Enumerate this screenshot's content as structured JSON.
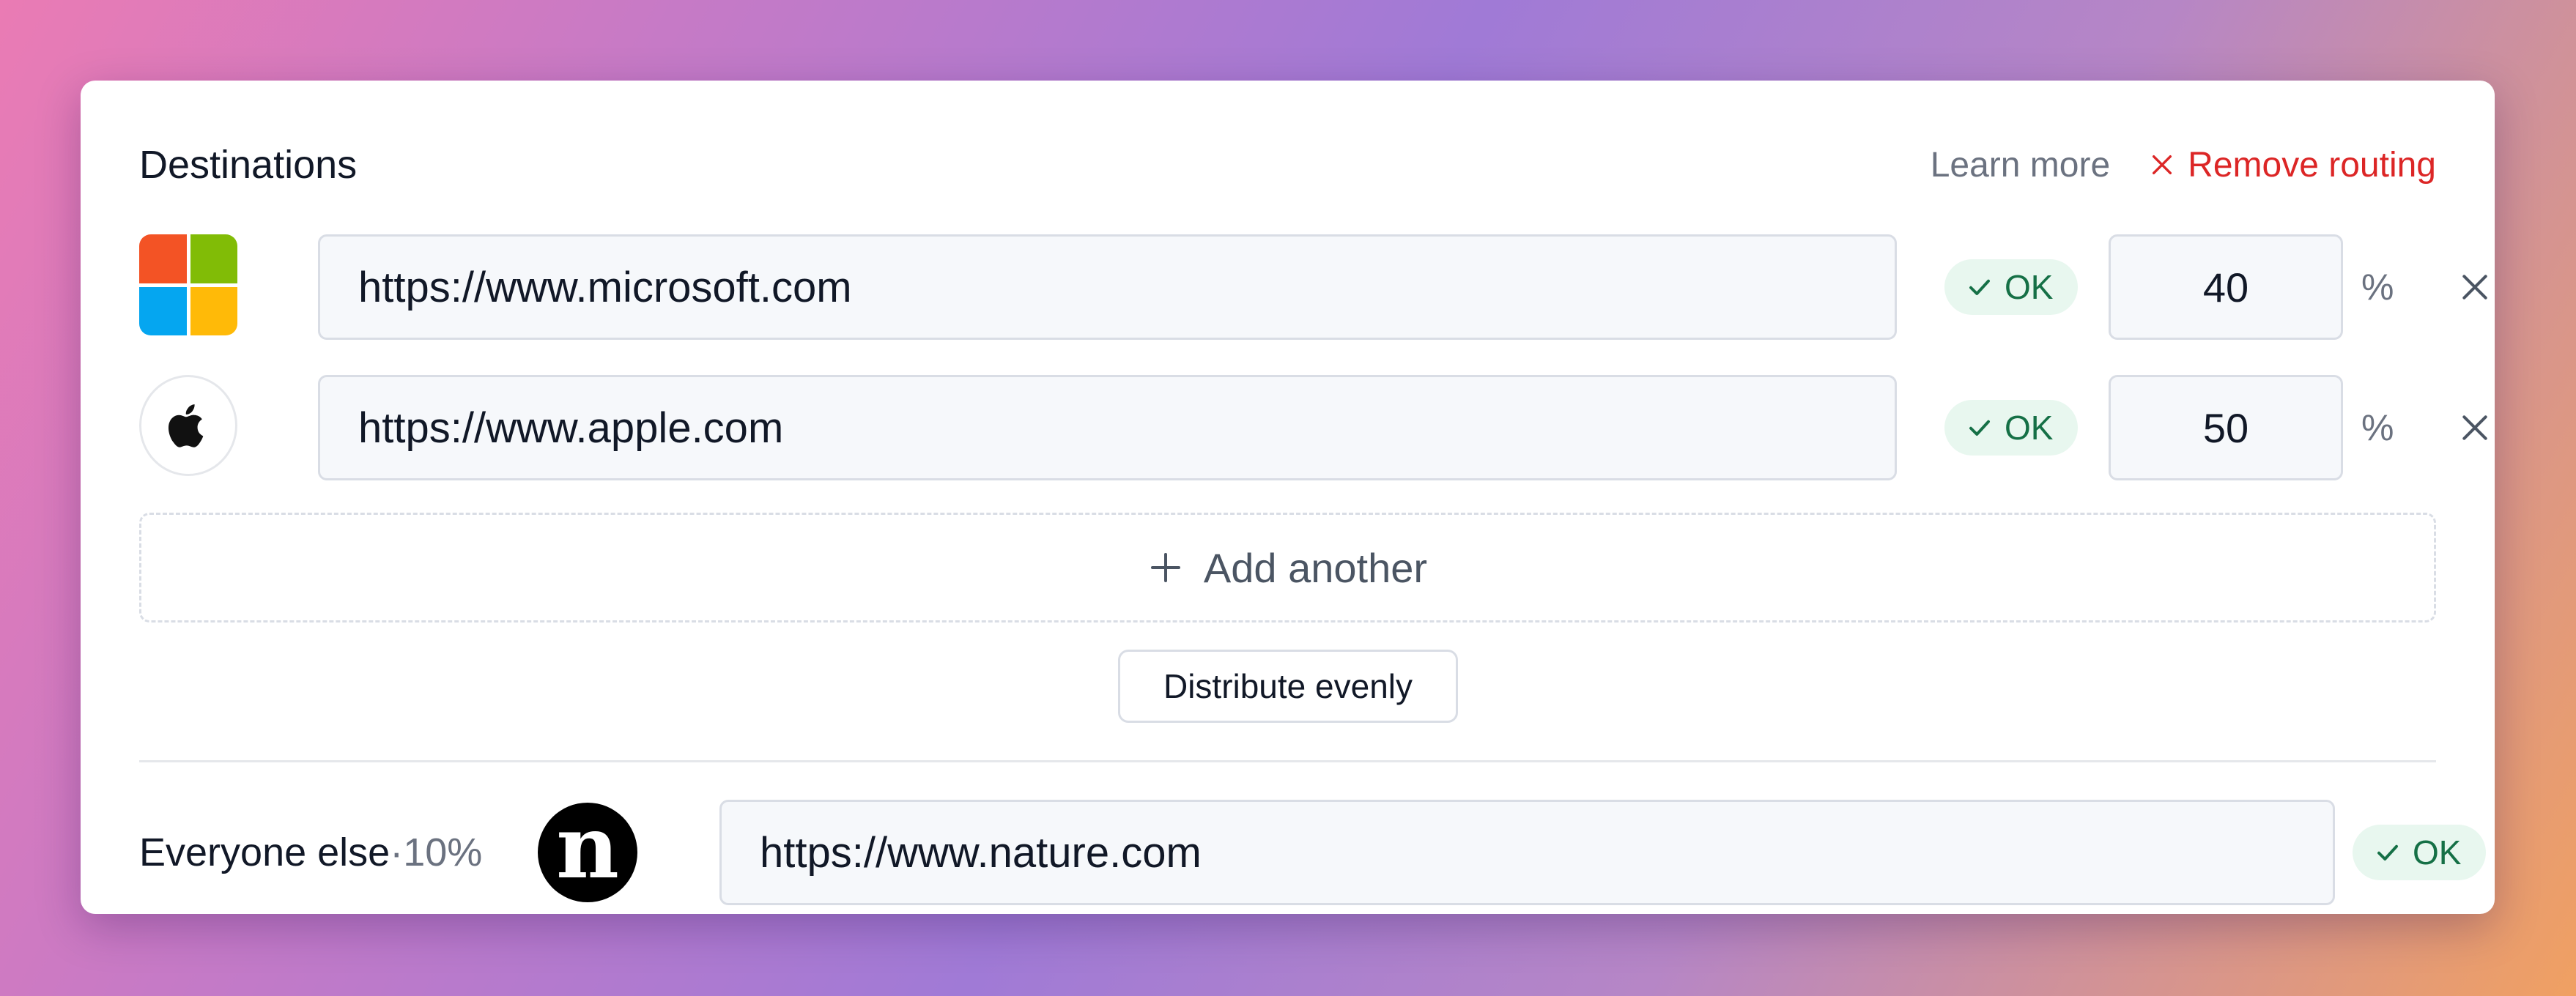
{
  "header": {
    "title": "Destinations",
    "learn_more": "Learn more",
    "remove_routing": "Remove routing"
  },
  "destinations": [
    {
      "logo_icon": "microsoft-logo-icon",
      "url": "https://www.microsoft.com",
      "status": "OK",
      "percent": "40",
      "unit": "%"
    },
    {
      "logo_icon": "apple-logo-icon",
      "url": "https://www.apple.com",
      "status": "OK",
      "percent": "50",
      "unit": "%"
    }
  ],
  "add_another": "Add another",
  "distribute_evenly": "Distribute evenly",
  "everyone_else": {
    "label": "Everyone else",
    "separator": " · ",
    "percent": "10%",
    "logo_icon": "nature-logo-icon",
    "logo_letter": "n",
    "url": "https://www.nature.com",
    "status": "OK"
  },
  "colors": {
    "danger": "#dc2626",
    "ok_text": "#157046",
    "ok_bg": "#e8f7ef",
    "microsoft_red": "#f35325",
    "microsoft_green": "#81bc06",
    "microsoft_blue": "#05a6f0",
    "microsoft_yellow": "#ffba08"
  }
}
